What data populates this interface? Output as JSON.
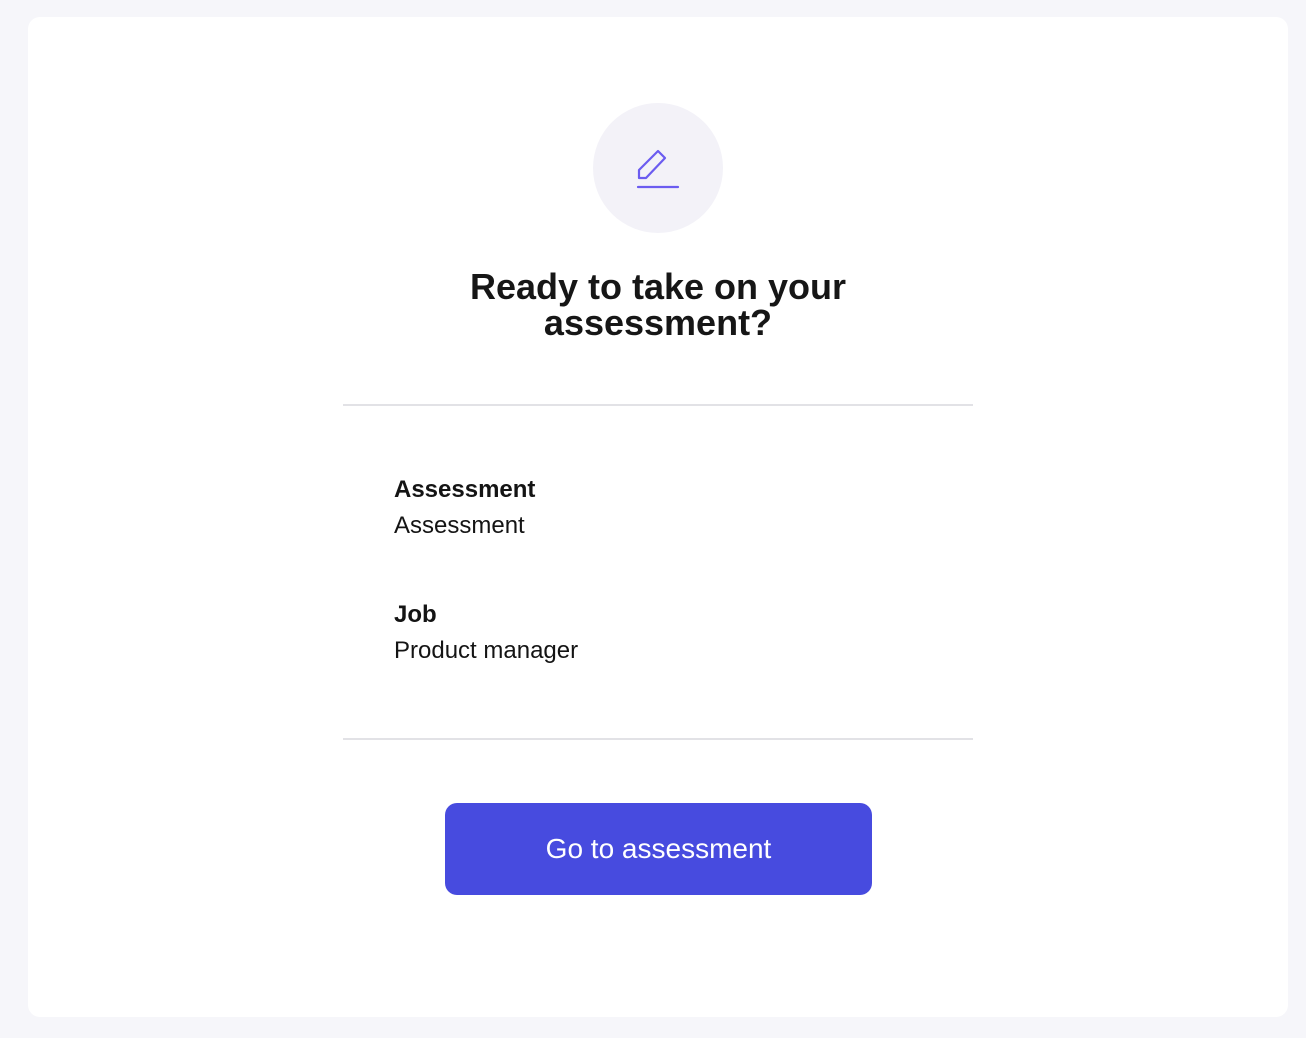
{
  "card": {
    "icon": "pencil-edit-icon",
    "title": "Ready to take on your assessment?",
    "details": [
      {
        "label": "Assessment",
        "value": "Assessment"
      },
      {
        "label": "Job",
        "value": "Product manager"
      }
    ],
    "cta_label": "Go to assessment"
  },
  "colors": {
    "page_background": "#f6f6fa",
    "card_background": "#ffffff",
    "icon_circle": "#f3f2f8",
    "accent": "#6b5cf0",
    "button": "#474bdf",
    "button_text": "#ffffff",
    "divider": "#e2e2e6"
  }
}
